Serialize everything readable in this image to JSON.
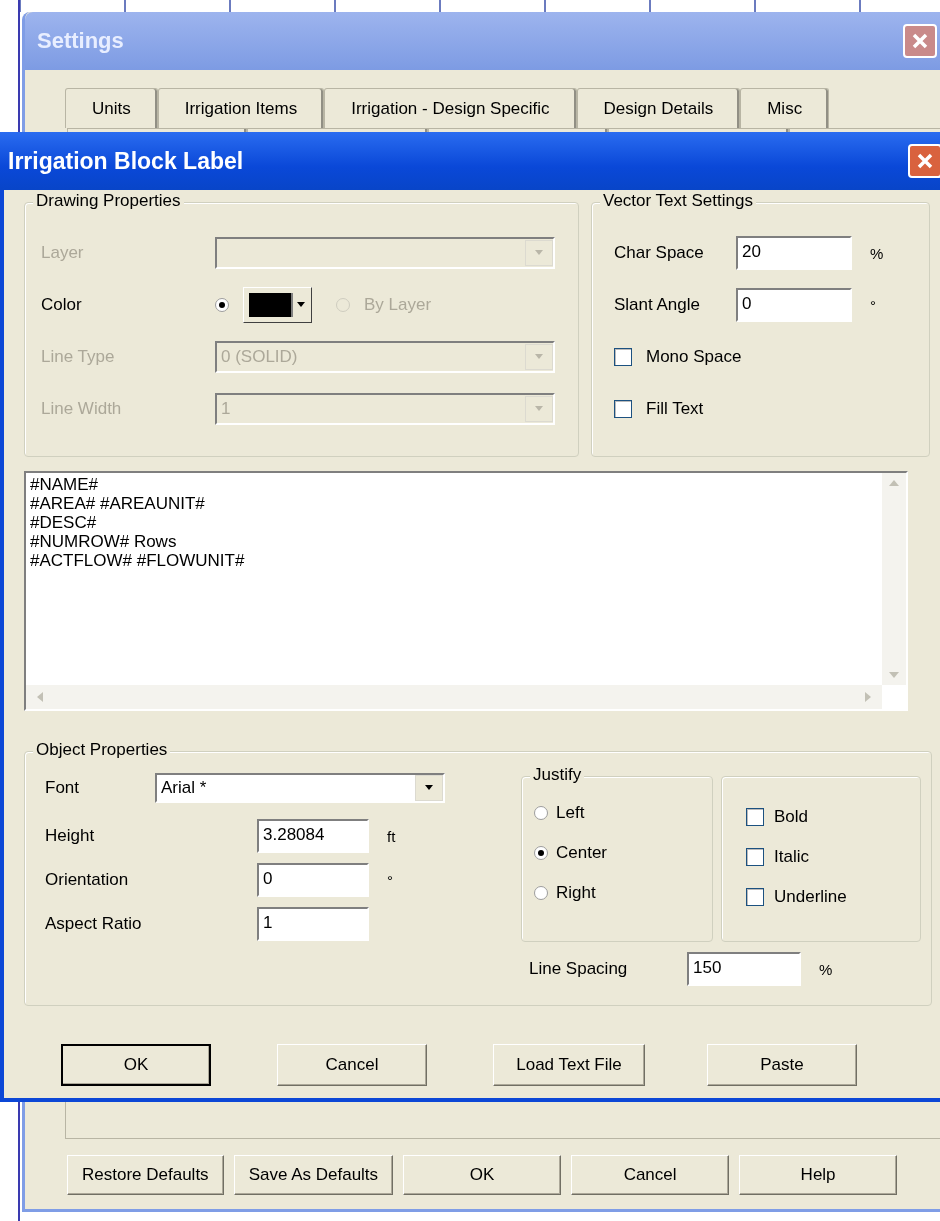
{
  "settings_window": {
    "title": "Settings",
    "tabs": [
      {
        "label": "Units",
        "selected": false
      },
      {
        "label": "Irrigation Items",
        "selected": false
      },
      {
        "label": "Irrigation - Design Specific",
        "selected": false
      },
      {
        "label": "Design Details",
        "selected": false
      },
      {
        "label": "Misc",
        "selected": false
      }
    ],
    "buttons": [
      "Restore Defaults",
      "Save As Defaults",
      "OK",
      "Cancel",
      "Help"
    ]
  },
  "dialog": {
    "title": "Irrigation Block Label",
    "drawing_properties": {
      "title": "Drawing Properties",
      "layer": {
        "label": "Layer",
        "disabled": true
      },
      "color": {
        "label": "Color",
        "swatch_selected": true,
        "by_layer_label": "By Layer",
        "by_layer_selected": false,
        "by_layer_disabled": true
      },
      "line_type": {
        "label": "Line Type",
        "value": "0 (SOLID)",
        "disabled": true
      },
      "line_width": {
        "label": "Line Width",
        "value": "1",
        "disabled": true
      }
    },
    "vector_text_settings": {
      "title": "Vector Text Settings",
      "fields": [
        {
          "label": "Char Space",
          "value": "20",
          "unit": "%"
        },
        {
          "label": "Slant Angle",
          "value": "0",
          "unit": "°"
        }
      ],
      "checkboxes": [
        {
          "label": "Mono Space",
          "checked": false
        },
        {
          "label": "Fill Text",
          "checked": false
        }
      ]
    },
    "text_body": [
      "#NAME#",
      "#AREA# #AREAUNIT#",
      "#DESC#",
      "#NUMROW# Rows",
      "#ACTFLOW# #FLOWUNIT#"
    ],
    "object_properties": {
      "title": "Object Properties",
      "font": {
        "label": "Font",
        "value": "Arial *"
      },
      "fields": [
        {
          "label": "Height",
          "value": "3.28084",
          "unit": "ft"
        },
        {
          "label": "Orientation",
          "value": "0",
          "unit": "°"
        },
        {
          "label": "Aspect Ratio",
          "value": "1"
        }
      ],
      "justify": {
        "title": "Justify",
        "options": [
          {
            "label": "Left",
            "selected": false
          },
          {
            "label": "Center",
            "selected": true
          },
          {
            "label": "Right",
            "selected": false
          }
        ]
      },
      "styles": [
        {
          "label": "Bold",
          "checked": false
        },
        {
          "label": "Italic",
          "checked": false
        },
        {
          "label": "Underline",
          "checked": false
        }
      ],
      "line_spacing": {
        "label": "Line Spacing",
        "value": "150",
        "unit": "%"
      }
    },
    "buttons": [
      {
        "label": "OK",
        "default": true
      },
      {
        "label": "Cancel",
        "default": false
      },
      {
        "label": "Load Text File",
        "default": false
      },
      {
        "label": "Paste",
        "default": false
      }
    ]
  }
}
